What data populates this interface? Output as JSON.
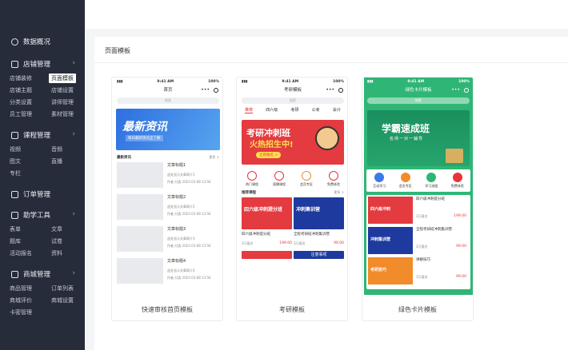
{
  "sidebar": {
    "s1": "数据概况",
    "s2": "店铺管理",
    "g2": [
      "店铺装修",
      "页面模板",
      "店铺主题",
      "店铺设置",
      "分类设置",
      "讲师管理",
      "员工管理",
      "素材管理"
    ],
    "s3": "课程管理",
    "g3": [
      "视频",
      "音频",
      "图文",
      "直播",
      "专栏"
    ],
    "s4": "订单管理",
    "s5": "助学工具",
    "g5": [
      "表单",
      "文章",
      "题库",
      "试卷",
      "活动报名",
      "资料"
    ],
    "s6": "商城管理",
    "g6": [
      "商品管理",
      "订单列表",
      "商城评价",
      "商城设置",
      "卡密管理"
    ]
  },
  "main": {
    "title": "页面模板"
  },
  "templates": [
    {
      "caption": "快速审核首页模板",
      "nav_title": "首页",
      "banner_title": "最新资讯",
      "banner_sub": "每日最新资讯全了解",
      "section": "最新资讯",
      "more": "更多 >",
      "items": [
        {
          "t": "文章标题1",
          "d": "此处显示文章简介1"
        },
        {
          "t": "文章标题2",
          "d": "此处显示文章简介2"
        },
        {
          "t": "文章标题3",
          "d": "此处显示文章简介3"
        },
        {
          "t": "文章标题4",
          "d": "此处显示文章简介4"
        }
      ],
      "meta": "作者 分类 2021-03-08 13:56"
    },
    {
      "caption": "考研模板",
      "nav_title": "考研模板",
      "tabs": [
        "推荐",
        "四六级",
        "考研",
        "公考",
        "会计"
      ],
      "banner_title": "考研冲刺班",
      "banner_sub": "火热招生中!",
      "banner_btn": "立即报名 >",
      "icons": [
        "热门课程",
        "直播课程",
        "会员专区",
        "免费体验"
      ],
      "section": "推荐课程",
      "more": "更多 >",
      "courses": [
        {
          "img": "四六级冲刺提分班",
          "name": "四六级冲刺提分班",
          "price": "199.00"
        },
        {
          "img": "冲刺集训营",
          "name": "全程考研班冲刺集训营",
          "price": "99.00"
        }
      ],
      "sold": "3万报名",
      "bottom": "注意事项"
    },
    {
      "caption": "绿色卡片模板",
      "nav_title": "绿色卡片模板",
      "banner_title": "学霸速成班",
      "banner_sub": "名师一对一辅导",
      "icons": [
        "互动学习",
        "会员专区",
        "学习进度",
        "免费体验"
      ],
      "items": [
        {
          "img": "四六级冲刺",
          "name": "四六级冲刺提分班",
          "price": "199.00"
        },
        {
          "img": "冲刺集训营",
          "name": "全程考研班冲刺集训营",
          "price": "99.00"
        },
        {
          "img": "考研技巧",
          "name": "讲解技巧",
          "price": "99.00"
        }
      ],
      "sold": "3万报名"
    }
  ],
  "status": {
    "time": "9:41 AM",
    "battery": "100%",
    "search": "搜索"
  },
  "colors": {
    "sidebar": "#272c3b",
    "blue": "#3a7be8",
    "red": "#e8343a",
    "green": "#2fb676"
  }
}
